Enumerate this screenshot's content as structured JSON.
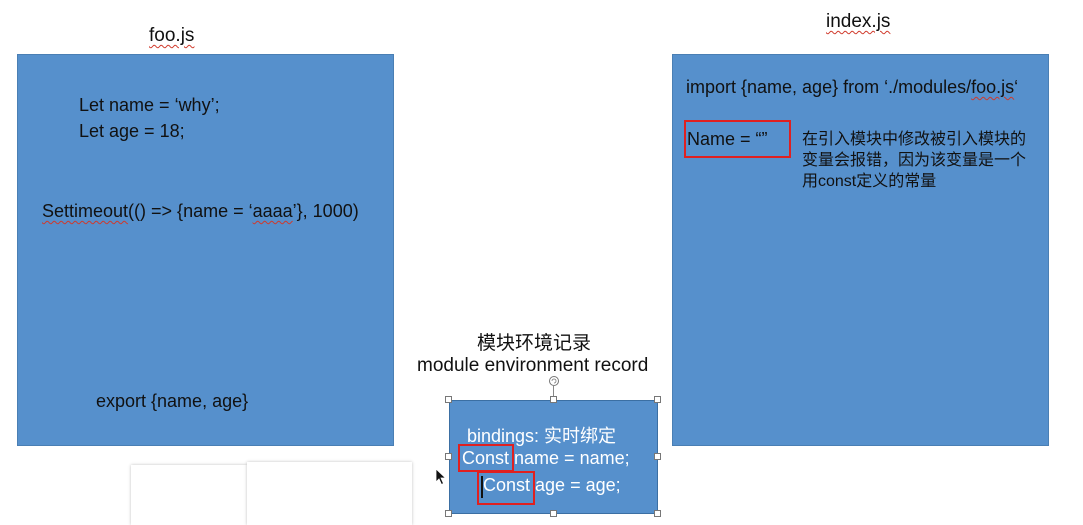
{
  "foo": {
    "title": "foo.js",
    "line1": "Let name = ‘why’;",
    "line2": "Let age = 18;",
    "line3_word": "Settimeout",
    "line3_rest": "(() => {name = ‘",
    "line3_val": "aaaa",
    "line3_end": "’}, 1000)",
    "export": "export {name, age}"
  },
  "index": {
    "title": "index.js",
    "import_text": "import {name, age} from ‘./modules/",
    "import_file": "foo.js",
    "import_end": "‘",
    "assign": "Name = “”",
    "note": "在引入模块中修改被引入模块的变量会报错，因为该变量是一个用const定义的常量"
  },
  "record": {
    "title_cn": "模块环境记录",
    "title_en": "module environment record",
    "bindings": "bindings: 实时绑定",
    "line1_kw": "Const",
    "line1_rest": " name = name;",
    "line2_kw": "Const",
    "line2_rest": " age = age;"
  },
  "colors": {
    "panel": "#5690cc",
    "highlight": "#e02020"
  }
}
